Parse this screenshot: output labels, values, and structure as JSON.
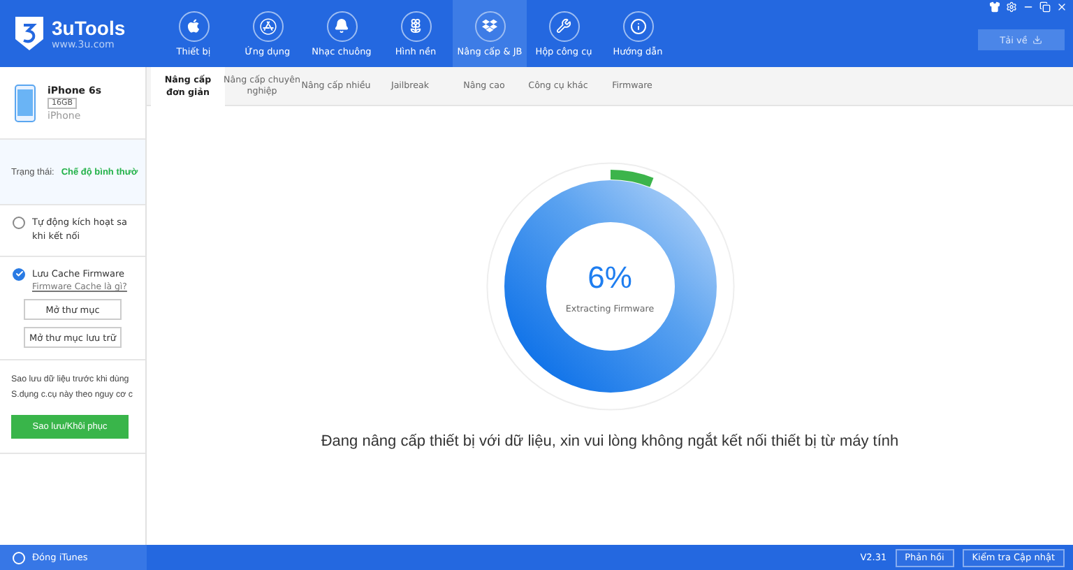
{
  "app": {
    "name": "3uTools",
    "url": "www.3u.com"
  },
  "nav": [
    {
      "label": "Thiết bị",
      "selected": false
    },
    {
      "label": "Ứng dụng",
      "selected": false
    },
    {
      "label": "Nhạc chuông",
      "selected": false
    },
    {
      "label": "Hình nền",
      "selected": false
    },
    {
      "label": "Nâng cấp & JB",
      "selected": true
    },
    {
      "label": "Hộp công cụ",
      "selected": false
    },
    {
      "label": "Hướng dẫn",
      "selected": false
    }
  ],
  "download_button": "Tải về",
  "device": {
    "name": "iPhone 6s",
    "capacity": "16GB",
    "type": "iPhone"
  },
  "status": {
    "label": "Trạng thái:",
    "value": "Chế độ bình thườ"
  },
  "options": [
    {
      "kind": "radio",
      "label": "Tự động kích hoạt sa\nkhi kết nối",
      "checked": false
    },
    {
      "kind": "check",
      "label": "Lưu Cache Firmware",
      "checked": true,
      "link": "Firmware Cache là gì?"
    }
  ],
  "folder_buttons": [
    "Mở thư mục",
    "Mở thư mục lưu trữ"
  ],
  "backup": {
    "lines": [
      "Sao lưu dữ liệu trước khi dùng",
      "S.dụng c.cụ này theo nguy cơ c"
    ],
    "button": "Sao lưu/Khôi phục"
  },
  "tabs": [
    {
      "label": "Nâng cấp\nđơn giản",
      "selected": true
    },
    {
      "label": "Nâng cấp chuyên\nnghiệp",
      "selected": false
    },
    {
      "label": "Nâng cấp nhiều",
      "selected": false
    },
    {
      "label": "Jailbreak",
      "selected": false
    },
    {
      "label": "Nâng cao",
      "selected": false
    },
    {
      "label": "Công cụ khác",
      "selected": false
    },
    {
      "label": "Firmware",
      "selected": false
    }
  ],
  "progress": {
    "percent": "6%",
    "step": "Extracting Firmware",
    "level": 0.06
  },
  "message": "Đang nâng cấp thiết bị với dữ liệu, xin vui lòng không ngắt kết nối thiết bị từ máy tính",
  "footer": {
    "itunes": "Đóng iTunes",
    "version": "V2.31",
    "buttons": [
      "Phản hồi",
      "Kiểm tra Cập nhật"
    ]
  }
}
